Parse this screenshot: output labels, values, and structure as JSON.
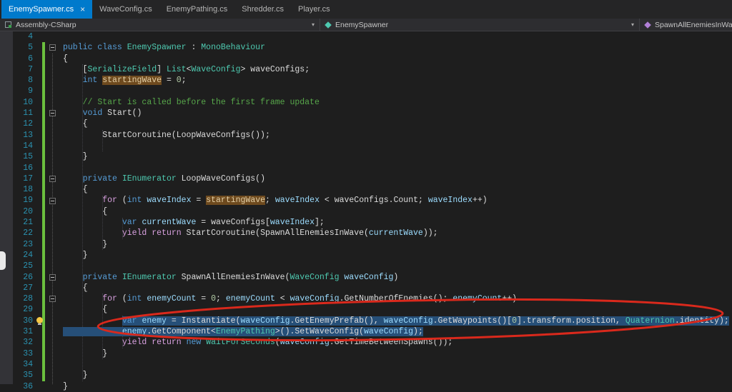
{
  "tabs": [
    {
      "label": "EnemySpawner.cs",
      "active": true,
      "close": true
    },
    {
      "label": "WaveConfig.cs",
      "active": false,
      "close": false
    },
    {
      "label": "EnemyPathing.cs",
      "active": false,
      "close": false
    },
    {
      "label": "Shredder.cs",
      "active": false,
      "close": false
    },
    {
      "label": "Player.cs",
      "active": false,
      "close": false
    }
  ],
  "navbar": {
    "sections": [
      {
        "name": "project-dropdown",
        "icon": "project",
        "label": "Assembly-CSharp",
        "chevron": true
      },
      {
        "name": "type-dropdown",
        "icon": "class",
        "label": "EnemySpawner",
        "chevron": true
      },
      {
        "name": "member-dropdown",
        "icon": "method",
        "label": "SpawnAllEnemiesInWave(Wa",
        "chevron": false
      }
    ]
  },
  "colors": {
    "active_tab": "#007acc",
    "selection": "#264f78",
    "reference_highlight": "#6e4a1e",
    "change_bar": "#6bbf3e",
    "annotation": "#da291c",
    "keyword": "#569cd6",
    "control_keyword": "#d8a0df",
    "type": "#4ec9b0",
    "local": "#9cdcfe",
    "comment": "#57a64a",
    "number": "#b5cea8",
    "line_number": "#2b91af"
  },
  "editor": {
    "lines": [
      {
        "n": 4,
        "chg": false,
        "tokens": []
      },
      {
        "n": 5,
        "chg": true,
        "fold": true,
        "tokens": [
          [
            "k",
            "public class "
          ],
          [
            "t",
            "EnemySpawner"
          ],
          [
            "d",
            " : "
          ],
          [
            "t",
            "MonoBehaviour"
          ]
        ]
      },
      {
        "n": 6,
        "chg": true,
        "tokens": [
          [
            "d",
            "{"
          ]
        ]
      },
      {
        "n": 7,
        "chg": true,
        "tokens": [
          [
            "d",
            "    ["
          ],
          [
            "t",
            "SerializeField"
          ],
          [
            "d",
            "] "
          ],
          [
            "t",
            "List"
          ],
          [
            "d",
            "<"
          ],
          [
            "t",
            "WaveConfig"
          ],
          [
            "d",
            "> waveConfigs;"
          ]
        ]
      },
      {
        "n": 8,
        "chg": true,
        "tokens": [
          [
            "d",
            "    "
          ],
          [
            "k",
            "int"
          ],
          [
            "d",
            " "
          ],
          [
            "ref",
            "startingWave"
          ],
          [
            "d",
            " = "
          ],
          [
            "n",
            "0"
          ],
          [
            "d",
            ";"
          ]
        ]
      },
      {
        "n": 9,
        "chg": true,
        "tokens": []
      },
      {
        "n": 10,
        "chg": true,
        "tokens": [
          [
            "d",
            "    "
          ],
          [
            "c",
            "// Start is called before the first frame update"
          ]
        ]
      },
      {
        "n": 11,
        "chg": true,
        "fold": true,
        "tokens": [
          [
            "d",
            "    "
          ],
          [
            "k",
            "void"
          ],
          [
            "d",
            " Start()"
          ]
        ]
      },
      {
        "n": 12,
        "chg": true,
        "tokens": [
          [
            "d",
            "    {"
          ]
        ]
      },
      {
        "n": 13,
        "chg": true,
        "tokens": [
          [
            "d",
            "        StartCoroutine(LoopWaveConfigs());"
          ]
        ]
      },
      {
        "n": 14,
        "chg": true,
        "tokens": []
      },
      {
        "n": 15,
        "chg": true,
        "tokens": [
          [
            "d",
            "    }"
          ]
        ]
      },
      {
        "n": 16,
        "chg": true,
        "tokens": []
      },
      {
        "n": 17,
        "chg": true,
        "fold": true,
        "tokens": [
          [
            "d",
            "    "
          ],
          [
            "k",
            "private"
          ],
          [
            "d",
            " "
          ],
          [
            "t",
            "IEnumerator"
          ],
          [
            "d",
            " LoopWaveConfigs()"
          ]
        ]
      },
      {
        "n": 18,
        "chg": true,
        "tokens": [
          [
            "d",
            "    {"
          ]
        ]
      },
      {
        "n": 19,
        "chg": true,
        "fold": true,
        "tokens": [
          [
            "d",
            "        "
          ],
          [
            "cf",
            "for"
          ],
          [
            "d",
            " ("
          ],
          [
            "k",
            "int"
          ],
          [
            "d",
            " "
          ],
          [
            "v",
            "waveIndex"
          ],
          [
            "d",
            " = "
          ],
          [
            "ref",
            "startingWave"
          ],
          [
            "d",
            "; "
          ],
          [
            "v",
            "waveIndex"
          ],
          [
            "d",
            " < waveConfigs.Count; "
          ],
          [
            "v",
            "waveIndex"
          ],
          [
            "d",
            "++)"
          ]
        ]
      },
      {
        "n": 20,
        "chg": true,
        "tokens": [
          [
            "d",
            "        {"
          ]
        ]
      },
      {
        "n": 21,
        "chg": true,
        "tokens": [
          [
            "d",
            "            "
          ],
          [
            "k",
            "var"
          ],
          [
            "d",
            " "
          ],
          [
            "v",
            "currentWave"
          ],
          [
            "d",
            " = waveConfigs["
          ],
          [
            "v",
            "waveIndex"
          ],
          [
            "d",
            "];"
          ]
        ]
      },
      {
        "n": 22,
        "chg": true,
        "tokens": [
          [
            "d",
            "            "
          ],
          [
            "cf",
            "yield return"
          ],
          [
            "d",
            " StartCoroutine(SpawnAllEnemiesInWave("
          ],
          [
            "v",
            "currentWave"
          ],
          [
            "d",
            "));"
          ]
        ]
      },
      {
        "n": 23,
        "chg": true,
        "tokens": [
          [
            "d",
            "        }"
          ]
        ]
      },
      {
        "n": 24,
        "chg": true,
        "tokens": [
          [
            "d",
            "    }"
          ]
        ]
      },
      {
        "n": 25,
        "chg": true,
        "tokens": []
      },
      {
        "n": 26,
        "chg": true,
        "fold": true,
        "tokens": [
          [
            "d",
            "    "
          ],
          [
            "k",
            "private"
          ],
          [
            "d",
            " "
          ],
          [
            "t",
            "IEnumerator"
          ],
          [
            "d",
            " SpawnAllEnemiesInWave("
          ],
          [
            "t",
            "WaveConfig"
          ],
          [
            "d",
            " "
          ],
          [
            "v",
            "waveConfig"
          ],
          [
            "d",
            ")"
          ]
        ]
      },
      {
        "n": 27,
        "chg": true,
        "tokens": [
          [
            "d",
            "    {"
          ]
        ]
      },
      {
        "n": 28,
        "chg": true,
        "fold": true,
        "tokens": [
          [
            "d",
            "        "
          ],
          [
            "cf",
            "for"
          ],
          [
            "d",
            " ("
          ],
          [
            "k",
            "int"
          ],
          [
            "d",
            " "
          ],
          [
            "v",
            "enemyCount"
          ],
          [
            "d",
            " = "
          ],
          [
            "n",
            "0"
          ],
          [
            "d",
            "; "
          ],
          [
            "v",
            "enemyCount"
          ],
          [
            "d",
            " < "
          ],
          [
            "v",
            "waveConfig"
          ],
          [
            "d",
            ".GetNumberOfEnemies(); "
          ],
          [
            "v",
            "enemyCount"
          ],
          [
            "d",
            "++)"
          ]
        ]
      },
      {
        "n": 29,
        "chg": true,
        "tokens": [
          [
            "d",
            "        {"
          ]
        ]
      },
      {
        "n": 30,
        "chg": true,
        "bulb": true,
        "tokens": [
          [
            "d",
            "            "
          ],
          [
            "sel k",
            "var"
          ],
          [
            "sel d",
            " "
          ],
          [
            "sel v",
            "enemy"
          ],
          [
            "sel d",
            " = Instantiate("
          ],
          [
            "sel v",
            "waveConfig"
          ],
          [
            "sel d",
            ".GetEnemyPrefab(), "
          ],
          [
            "sel v",
            "waveConfig"
          ],
          [
            "sel d",
            ".GetWaypoints()["
          ],
          [
            "sel n",
            "0"
          ],
          [
            "sel d",
            "].transform.position, "
          ],
          [
            "sel t",
            "Quaternion"
          ],
          [
            "sel d",
            ".identity);"
          ]
        ]
      },
      {
        "n": 31,
        "chg": true,
        "tokens": [
          [
            "sel d",
            "            "
          ],
          [
            "sel v",
            "enemy"
          ],
          [
            "sel d",
            ".GetComponent<"
          ],
          [
            "sel t",
            "EnemyPathing"
          ],
          [
            "sel d",
            ">().SetWaveConfig("
          ],
          [
            "sel v",
            "waveConfig"
          ],
          [
            "sel d",
            ");"
          ]
        ]
      },
      {
        "n": 32,
        "chg": true,
        "tokens": [
          [
            "d",
            "            "
          ],
          [
            "cf",
            "yield return"
          ],
          [
            "d",
            " "
          ],
          [
            "k",
            "new"
          ],
          [
            "d",
            " "
          ],
          [
            "t",
            "WaitForSeconds"
          ],
          [
            "d",
            "("
          ],
          [
            "v",
            "waveConfig"
          ],
          [
            "d",
            ".GetTimeBetweenSpawns());"
          ]
        ]
      },
      {
        "n": 33,
        "chg": true,
        "tokens": [
          [
            "d",
            "        }"
          ]
        ]
      },
      {
        "n": 34,
        "chg": true,
        "tokens": []
      },
      {
        "n": 35,
        "chg": true,
        "tokens": [
          [
            "d",
            "    }"
          ]
        ]
      },
      {
        "n": 36,
        "chg": false,
        "tokens": [
          [
            "d",
            "}"
          ]
        ]
      }
    ]
  },
  "annotation": {
    "shape": "ellipse",
    "color": "#da291c",
    "circled_lines": "30-31"
  }
}
